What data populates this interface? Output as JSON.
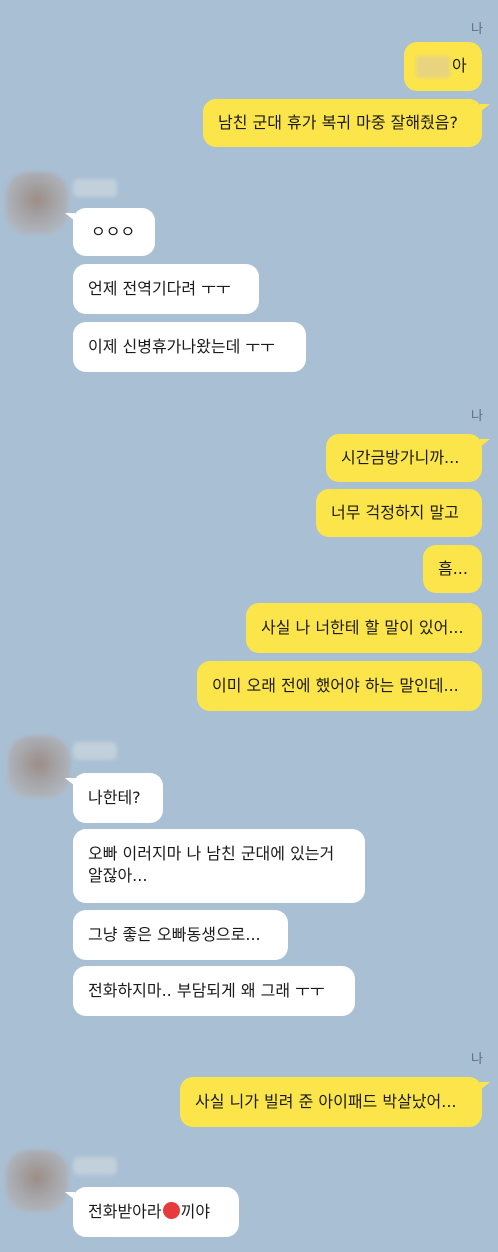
{
  "sender_label": "나",
  "messages": {
    "m1": "아",
    "m2": "남친 군대 휴가 복귀 마중 잘해줬음?",
    "r1": "ㅇㅇㅇ",
    "r2": "언제 전역기다려 ㅜㅜ",
    "r3": "이제 신병휴가나왔는데 ㅜㅜ",
    "m3": "시간금방가니까...",
    "m4": "너무 걱정하지 말고",
    "m5": "흠...",
    "m6": "사실 나 너한테 할 말이 있어...",
    "m7": "이미 오래 전에 했어야 하는 말인데...",
    "r4": "나한테?",
    "r5": "오빠 이러지마 나 남친 군대에 있는거 알잖아...",
    "r6": "그냥 좋은 오빠동생으로...",
    "r7": "전화하지마.. 부담되게 왜 그래 ㅜㅜ",
    "m8": "사실 니가 빌려 준 아이패드 박살났어...",
    "r8_before": "전화받아라",
    "r8_after": "끼야"
  },
  "colors": {
    "background": "#a9bfd4",
    "my_bubble": "#fce54b",
    "their_bubble": "#ffffff",
    "censor_dot": "#e53b3b"
  }
}
